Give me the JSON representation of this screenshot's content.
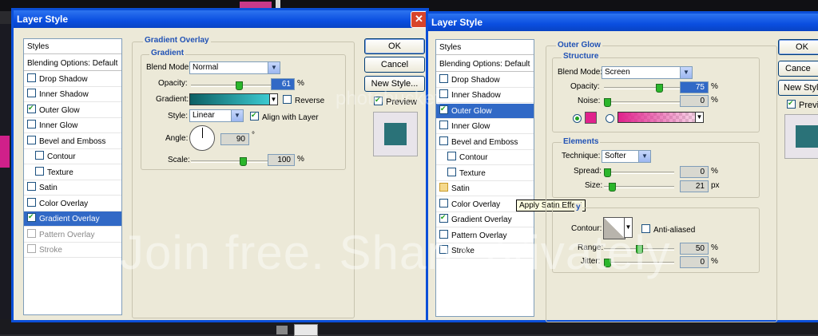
{
  "dialog1": {
    "title": "Layer Style",
    "styles_list": [
      {
        "label": "Styles",
        "kind": "header"
      },
      {
        "label": "Blending Options: Default",
        "kind": "header"
      },
      {
        "label": "Drop Shadow",
        "checked": false
      },
      {
        "label": "Inner Shadow",
        "checked": false
      },
      {
        "label": "Outer Glow",
        "checked": true
      },
      {
        "label": "Inner Glow",
        "checked": false
      },
      {
        "label": "Bevel and Emboss",
        "checked": false
      },
      {
        "label": "Contour",
        "checked": false,
        "indent": true
      },
      {
        "label": "Texture",
        "checked": false,
        "indent": true
      },
      {
        "label": "Satin",
        "checked": false
      },
      {
        "label": "Color Overlay",
        "checked": false
      },
      {
        "label": "Gradient Overlay",
        "checked": true,
        "selected": true
      },
      {
        "label": "Pattern Overlay",
        "checked": false,
        "dim": true
      },
      {
        "label": "Stroke",
        "checked": false,
        "dim": true
      }
    ],
    "section_title": "Gradient Overlay",
    "group_title": "Gradient",
    "blend_mode_label": "Blend Mode:",
    "blend_mode_value": "Normal",
    "opacity_label": "Opacity:",
    "opacity_value": "61",
    "opacity_pct": 61,
    "gradient_label": "Gradient:",
    "reverse_label": "Reverse",
    "style_label": "Style:",
    "style_value": "Linear",
    "align_label": "Align with Layer",
    "angle_label": "Angle:",
    "angle_value": "90",
    "degree_symbol": "°",
    "scale_label": "Scale:",
    "scale_value": "100",
    "scale_pct": 100,
    "percent": "%",
    "ok_label": "OK",
    "cancel_label": "Cancel",
    "new_style_label": "New Style...",
    "preview_label": "Preview",
    "preview_checked": true
  },
  "dialog2": {
    "title": "Layer Style",
    "styles_list": [
      {
        "label": "Styles",
        "kind": "header"
      },
      {
        "label": "Blending Options: Default",
        "kind": "header"
      },
      {
        "label": "Drop Shadow",
        "checked": false
      },
      {
        "label": "Inner Shadow",
        "checked": false
      },
      {
        "label": "Outer Glow",
        "checked": true,
        "selected": true
      },
      {
        "label": "Inner Glow",
        "checked": false
      },
      {
        "label": "Bevel and Emboss",
        "checked": false
      },
      {
        "label": "Contour",
        "checked": false,
        "indent": true
      },
      {
        "label": "Texture",
        "checked": false,
        "indent": true
      },
      {
        "label": "Satin",
        "checked": false,
        "hover": true
      },
      {
        "label": "Color Overlay",
        "checked": false
      },
      {
        "label": "Gradient Overlay",
        "checked": true
      },
      {
        "label": "Pattern Overlay",
        "checked": false
      },
      {
        "label": "Stroke",
        "checked": false
      }
    ],
    "tooltip": "Apply Satin Effect",
    "section_title": "Outer Glow",
    "structure_title": "Structure",
    "blend_mode_label": "Blend Mode:",
    "blend_mode_value": "Screen",
    "opacity_label": "Opacity:",
    "opacity_value": "75",
    "opacity_pct": 75,
    "noise_label": "Noise:",
    "noise_value": "0",
    "noise_pct": 0,
    "elements_title": "Elements",
    "technique_label": "Technique:",
    "technique_value": "Softer",
    "spread_label": "Spread:",
    "spread_value": "0",
    "spread_pct": 0,
    "size_label": "Size:",
    "size_value": "21",
    "size_fraction": 0.08,
    "px": "px",
    "quality_title": "y",
    "contour_label": "Contour:",
    "anti_aliased_label": "Anti-aliased",
    "range_label": "Range:",
    "range_value": "50",
    "range_pct": 50,
    "jitter_label": "Jitter:",
    "jitter_value": "0",
    "jitter_pct": 0,
    "percent": "%",
    "ok_label": "OK",
    "cancel_label": "Cance",
    "new_style_label": "New Styl",
    "preview_label": "Previe",
    "preview_checked": true
  },
  "watermark": {
    "main": "Join free. Share privately",
    "top": "photobucket"
  },
  "colors": {
    "glow": "#e0228c",
    "gradient_dark": "#0c5f63",
    "gradient_light": "#3fd1d8",
    "swatch": "#2a7278"
  }
}
